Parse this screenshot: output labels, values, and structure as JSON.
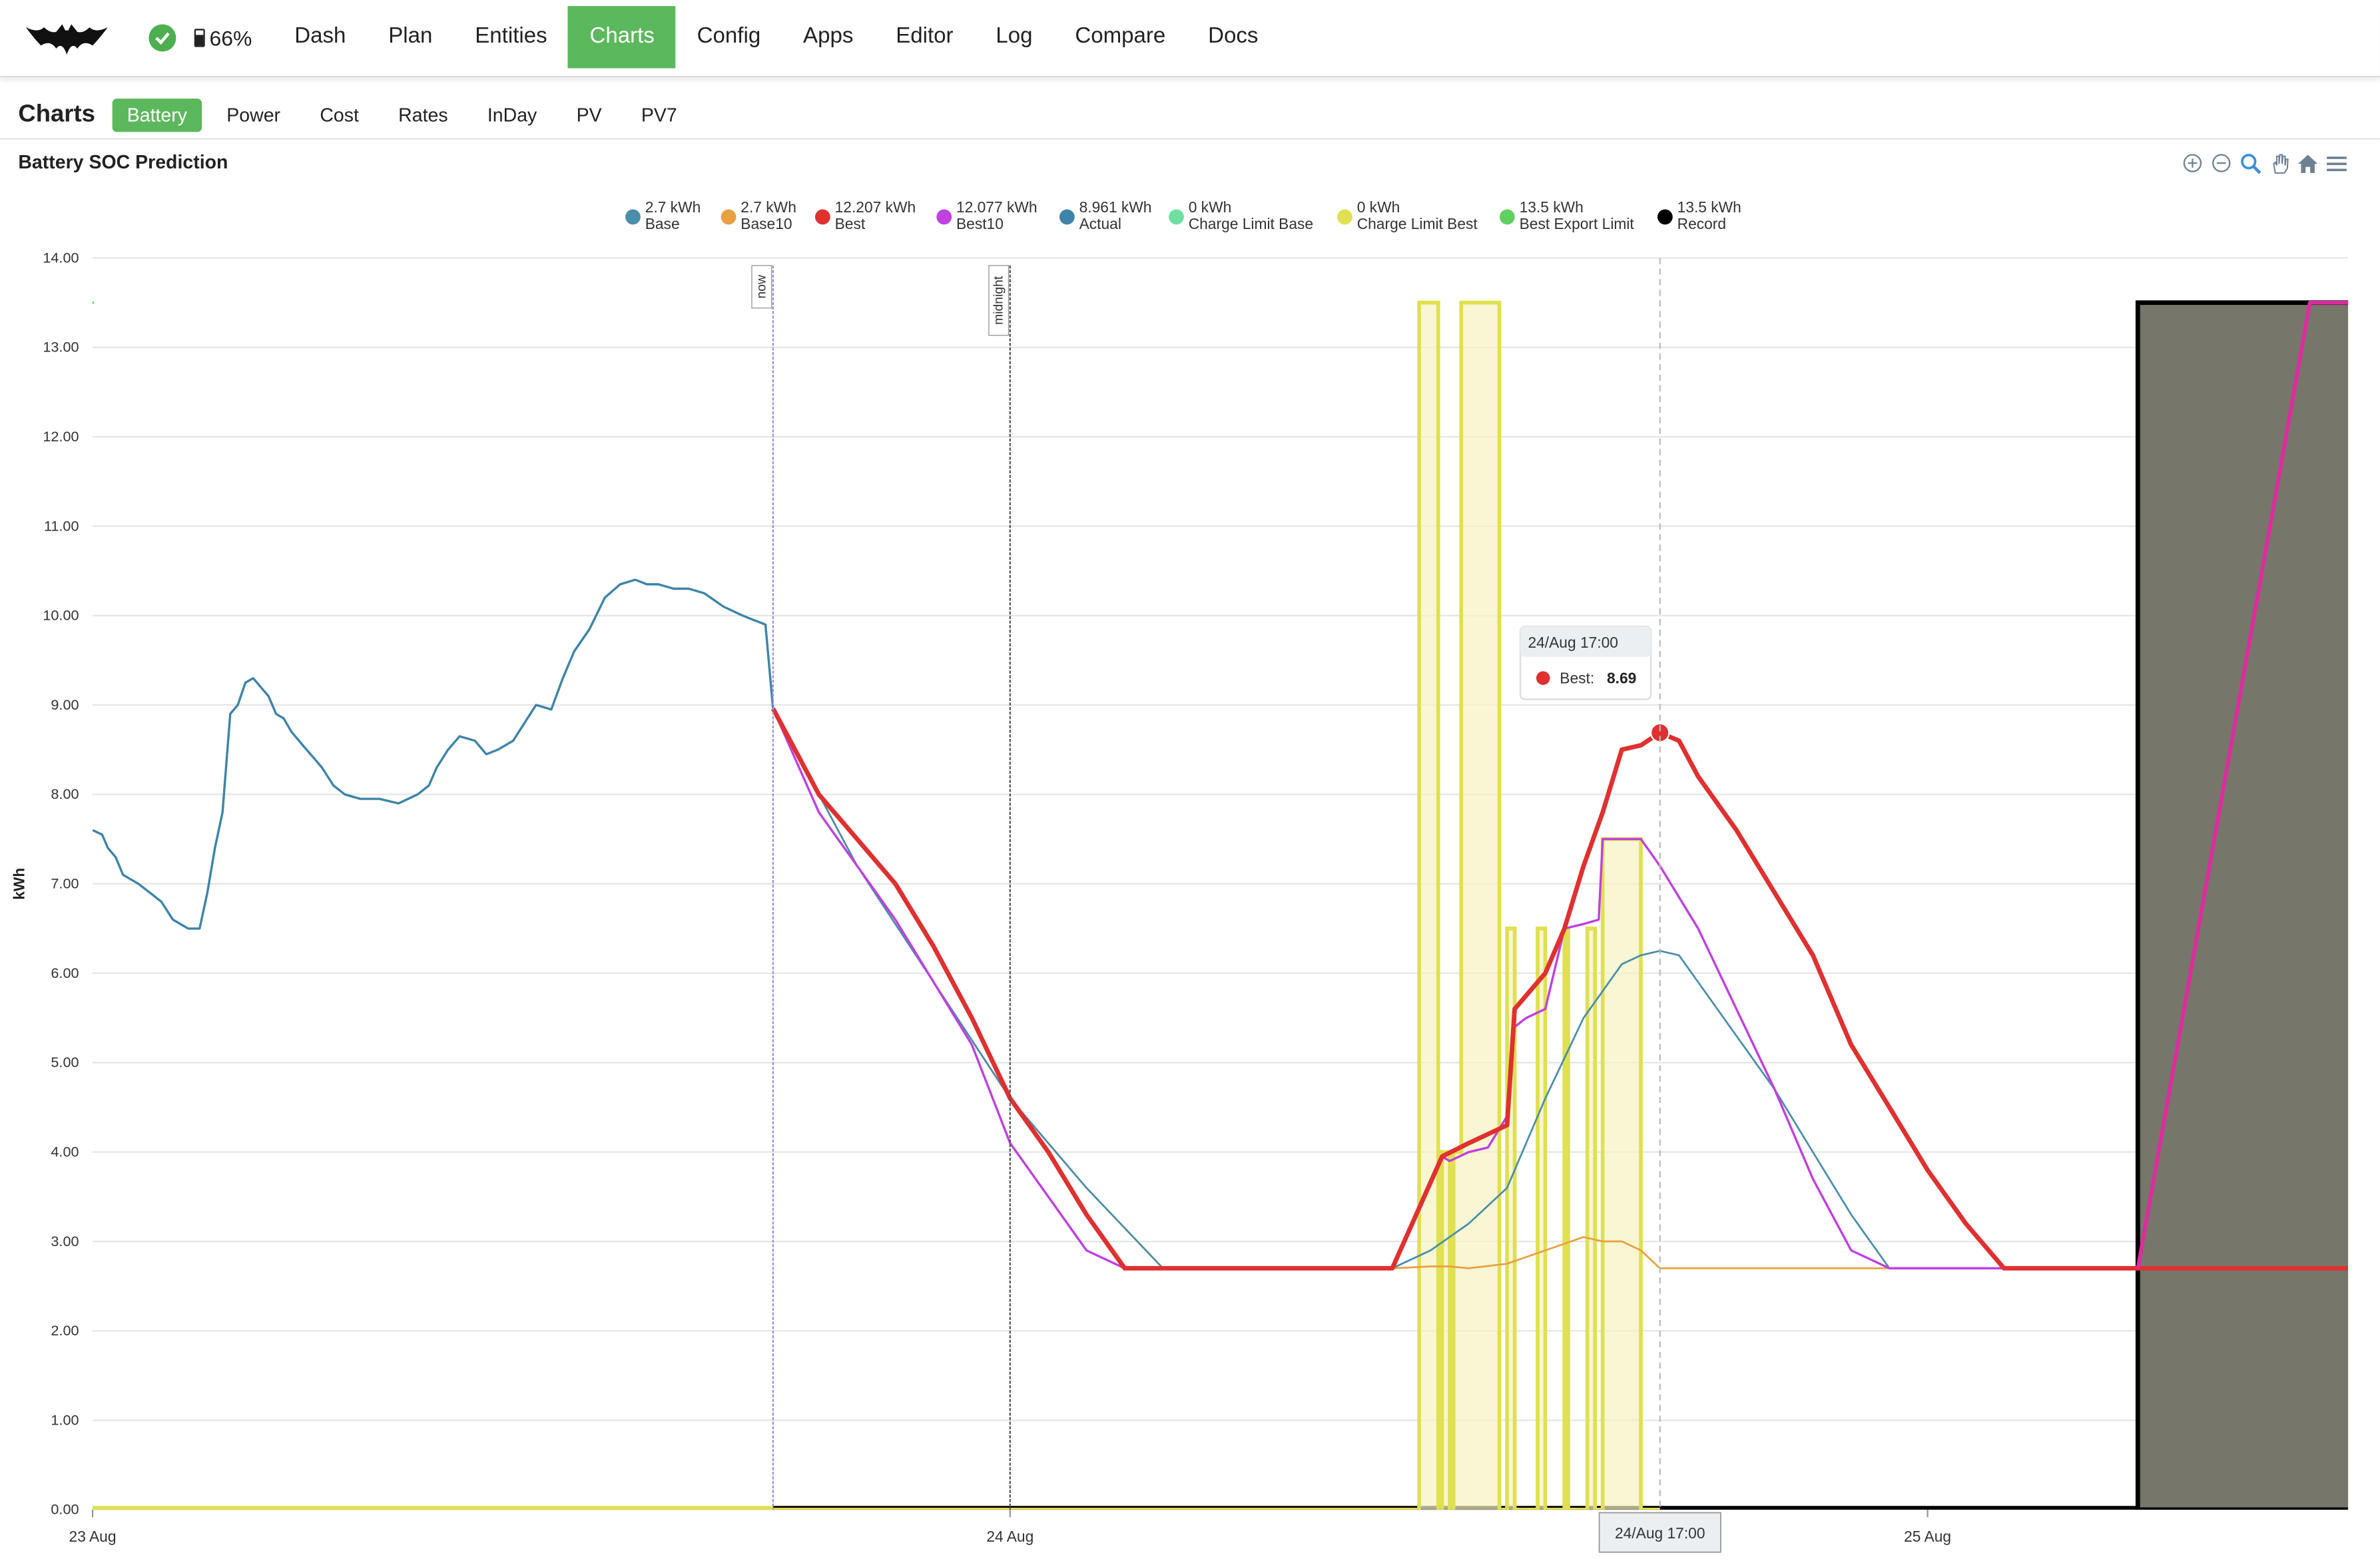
{
  "nav": {
    "logo_icon": "bat-logo-icon",
    "status_icon": "check-circle-icon",
    "battery_percent": "66%",
    "links": [
      "Dash",
      "Plan",
      "Entities",
      "Charts",
      "Config",
      "Apps",
      "Editor",
      "Log",
      "Compare",
      "Docs"
    ],
    "active": "Charts",
    "active_color": "#5cb85c"
  },
  "subnav": {
    "title": "Charts",
    "tabs": [
      "Battery",
      "Power",
      "Cost",
      "Rates",
      "InDay",
      "PV",
      "PV7"
    ],
    "active": "Battery"
  },
  "chart_title": "Battery SOC Prediction",
  "toolbar_icons": [
    "zoom-in-icon",
    "zoom-out-icon",
    "selection-zoom-icon",
    "pan-hand-icon",
    "reset-home-icon",
    "menu-icon"
  ],
  "tooltip": {
    "header": "24/Aug 17:00",
    "series": "Best",
    "label": "Best:",
    "value": "8.69"
  },
  "crosshair_label": "24/Aug 17:00",
  "chart_data": {
    "type": "line",
    "ylabel": "kWh",
    "ylim": [
      0,
      14
    ],
    "yticks": [
      "0.00",
      "1.00",
      "2.00",
      "3.00",
      "4.00",
      "5.00",
      "6.00",
      "7.00",
      "8.00",
      "9.00",
      "10.00",
      "11.00",
      "12.00",
      "13.00",
      "14.00"
    ],
    "xrange_hours": [
      0,
      59
    ],
    "xticks": [
      {
        "label": "23 Aug",
        "hour": 0
      },
      {
        "label": "24 Aug",
        "hour": 24
      },
      {
        "label": "25 Aug",
        "hour": 48
      }
    ],
    "annotations": [
      {
        "label": "now",
        "hour": 17.8,
        "color": "#a090e0"
      },
      {
        "label": "midnight",
        "hour": 24,
        "color": "#555555"
      }
    ],
    "crosshair_hour": 41,
    "legend": [
      {
        "value": "2.7 kWh",
        "name": "Base",
        "color": "#4a8eaa"
      },
      {
        "value": "2.7 kWh",
        "name": "Base10",
        "color": "#e8a040"
      },
      {
        "value": "12.207 kWh",
        "name": "Best",
        "color": "#e03030"
      },
      {
        "value": "12.077 kWh",
        "name": "Best10",
        "color": "#c040e0"
      },
      {
        "value": "8.961 kWh",
        "name": "Actual",
        "color": "#3e84a8"
      },
      {
        "value": "0 kWh",
        "name": "Charge Limit Base",
        "color": "#70e0a0"
      },
      {
        "value": "0 kWh",
        "name": "Charge Limit Best",
        "color": "#e0e050"
      },
      {
        "value": "13.5 kWh",
        "name": "Best Export Limit",
        "color": "#60d060"
      },
      {
        "value": "13.5 kWh",
        "name": "Record",
        "color": "#000000"
      }
    ],
    "series": [
      {
        "name": "Actual",
        "color": "#3e84a8",
        "width": 1.5,
        "x": [
          0,
          0.25,
          0.4,
          0.6,
          0.8,
          1,
          1.2,
          1.5,
          1.8,
          2.1,
          2.5,
          2.8,
          3,
          3.2,
          3.4,
          3.6,
          3.8,
          4,
          4.2,
          4.3,
          4.4,
          4.6,
          4.8,
          5,
          5.2,
          5.5,
          5.8,
          6,
          6.3,
          6.6,
          7,
          7.5,
          8,
          8.5,
          8.8,
          9,
          9.3,
          9.6,
          10,
          10.3,
          10.6,
          11,
          11.3,
          11.6,
          12,
          12.3,
          12.6,
          13,
          13.4,
          13.8,
          14.2,
          14.5,
          14.8,
          15.2,
          15.6,
          16,
          16.5,
          17,
          17.3,
          17.6,
          17.8
        ],
        "y": [
          7.6,
          7.55,
          7.4,
          7.3,
          7.1,
          7.05,
          7.0,
          6.9,
          6.8,
          6.6,
          6.5,
          6.5,
          6.9,
          7.4,
          7.8,
          8.9,
          9.0,
          9.25,
          9.3,
          9.25,
          9.2,
          9.1,
          8.9,
          8.85,
          8.7,
          8.55,
          8.4,
          8.3,
          8.1,
          8.0,
          7.95,
          7.95,
          7.9,
          8.0,
          8.1,
          8.3,
          8.5,
          8.65,
          8.6,
          8.45,
          8.5,
          8.6,
          8.8,
          9.0,
          8.95,
          9.3,
          9.6,
          9.85,
          10.2,
          10.35,
          10.4,
          10.35,
          10.35,
          10.3,
          10.3,
          10.25,
          10.1,
          10.0,
          9.95,
          9.9,
          8.96
        ]
      },
      {
        "name": "Base10",
        "color": "#e8a040",
        "width": 1.2,
        "x": [
          17.8,
          20,
          22,
          24,
          26,
          28,
          30,
          32,
          34,
          35,
          35.5,
          36,
          37,
          38,
          39,
          39.5,
          40,
          40.5,
          41,
          42,
          45,
          50,
          55,
          59
        ],
        "y": [
          8.96,
          7.2,
          5.9,
          4.6,
          3.6,
          2.7,
          2.7,
          2.7,
          2.7,
          2.72,
          2.72,
          2.7,
          2.75,
          2.9,
          3.05,
          3.0,
          3.0,
          2.9,
          2.7,
          2.7,
          2.7,
          2.7,
          2.7,
          2.7
        ]
      },
      {
        "name": "Base",
        "color": "#4a8eaa",
        "width": 1.2,
        "x": [
          17.8,
          20,
          22,
          24,
          26,
          28,
          30,
          32,
          34,
          35,
          36,
          37,
          38,
          39,
          40,
          40.5,
          41,
          41.5,
          42,
          43,
          44,
          45,
          46,
          47,
          58,
          59
        ],
        "y": [
          8.96,
          7.2,
          5.9,
          4.6,
          3.6,
          2.7,
          2.7,
          2.7,
          2.7,
          2.9,
          3.2,
          3.6,
          4.6,
          5.5,
          6.1,
          6.2,
          6.25,
          6.2,
          5.9,
          5.3,
          4.7,
          4.0,
          3.3,
          2.7,
          2.7,
          2.7
        ]
      },
      {
        "name": "Best10",
        "color": "#c040e0",
        "width": 1.5,
        "x": [
          17.8,
          19,
          20,
          21,
          22,
          23,
          24,
          25,
          26,
          27,
          28,
          30,
          32,
          34,
          35.3,
          35.5,
          36,
          36.5,
          37,
          37.2,
          37.5,
          38,
          38.5,
          39,
          39.4,
          39.5,
          40,
          40.5,
          41,
          42,
          43,
          44,
          45,
          46,
          47,
          48,
          50,
          52,
          55,
          58,
          59
        ],
        "y": [
          8.96,
          7.8,
          7.2,
          6.6,
          5.9,
          5.2,
          4.1,
          3.5,
          2.9,
          2.7,
          2.7,
          2.7,
          2.7,
          2.7,
          3.95,
          3.9,
          4.0,
          4.05,
          4.4,
          5.4,
          5.5,
          5.6,
          6.5,
          6.55,
          6.6,
          7.5,
          7.5,
          7.5,
          7.2,
          6.5,
          5.6,
          4.7,
          3.7,
          2.9,
          2.7,
          2.7,
          2.7,
          2.7,
          2.7,
          2.7,
          2.7
        ]
      },
      {
        "name": "Best",
        "color": "#e03030",
        "width": 3,
        "x": [
          17.8,
          19,
          20,
          21,
          22,
          23,
          24,
          25,
          26,
          27,
          28,
          30,
          32,
          34,
          35.3,
          36,
          37,
          37.2,
          38,
          38.5,
          39,
          39.5,
          40,
          40.5,
          41,
          41.5,
          42,
          43,
          44,
          45,
          46,
          47,
          48,
          49,
          50,
          51,
          52,
          53,
          54,
          55,
          58,
          59
        ],
        "y": [
          8.96,
          8.0,
          7.5,
          7.0,
          6.3,
          5.5,
          4.6,
          4.0,
          3.3,
          2.7,
          2.7,
          2.7,
          2.7,
          2.7,
          3.95,
          4.1,
          4.3,
          5.6,
          6.0,
          6.5,
          7.2,
          7.8,
          8.5,
          8.55,
          8.69,
          8.6,
          8.2,
          7.6,
          6.9,
          6.2,
          5.2,
          4.5,
          3.8,
          3.2,
          2.7,
          2.7,
          2.7,
          2.7,
          2.7,
          2.7,
          2.7,
          2.7
        ]
      },
      {
        "name": "Best Export Limit",
        "color": "#e02aa0",
        "width": 2.5,
        "x": [
          53.5,
          58,
          58.2,
          59.5,
          60.8,
          61.3,
          61.5,
          62,
          62.7,
          63.2,
          64
        ],
        "y": [
          2.7,
          13.5,
          13.5,
          13.5,
          13.5,
          13.5,
          13.5,
          12.9,
          12.5,
          12.2,
          12.0
        ]
      }
    ],
    "charge_limit_best": {
      "color": "#e0e050",
      "x": [
        0,
        17.8,
        34.7,
        35.2,
        35.3,
        35.5,
        35.6,
        35.8,
        36.8,
        37,
        37.2,
        37.8,
        38,
        38.5,
        38.6,
        39.1,
        39.3,
        39.5,
        39.6,
        40,
        40.5,
        40.8,
        41
      ],
      "y": [
        0,
        0,
        13.5,
        0,
        4.0,
        0,
        4.0,
        13.5,
        0,
        6.5,
        0,
        6.5,
        0,
        6.5,
        0,
        6.5,
        0,
        7.5,
        7.5,
        7.5,
        0,
        0,
        0
      ],
      "fill": "#f5f2c0"
    },
    "record_block": {
      "start_hour": 53.5,
      "end_hour": 59,
      "value": 13.5,
      "fill": "#76766a",
      "color": "#000000"
    }
  }
}
